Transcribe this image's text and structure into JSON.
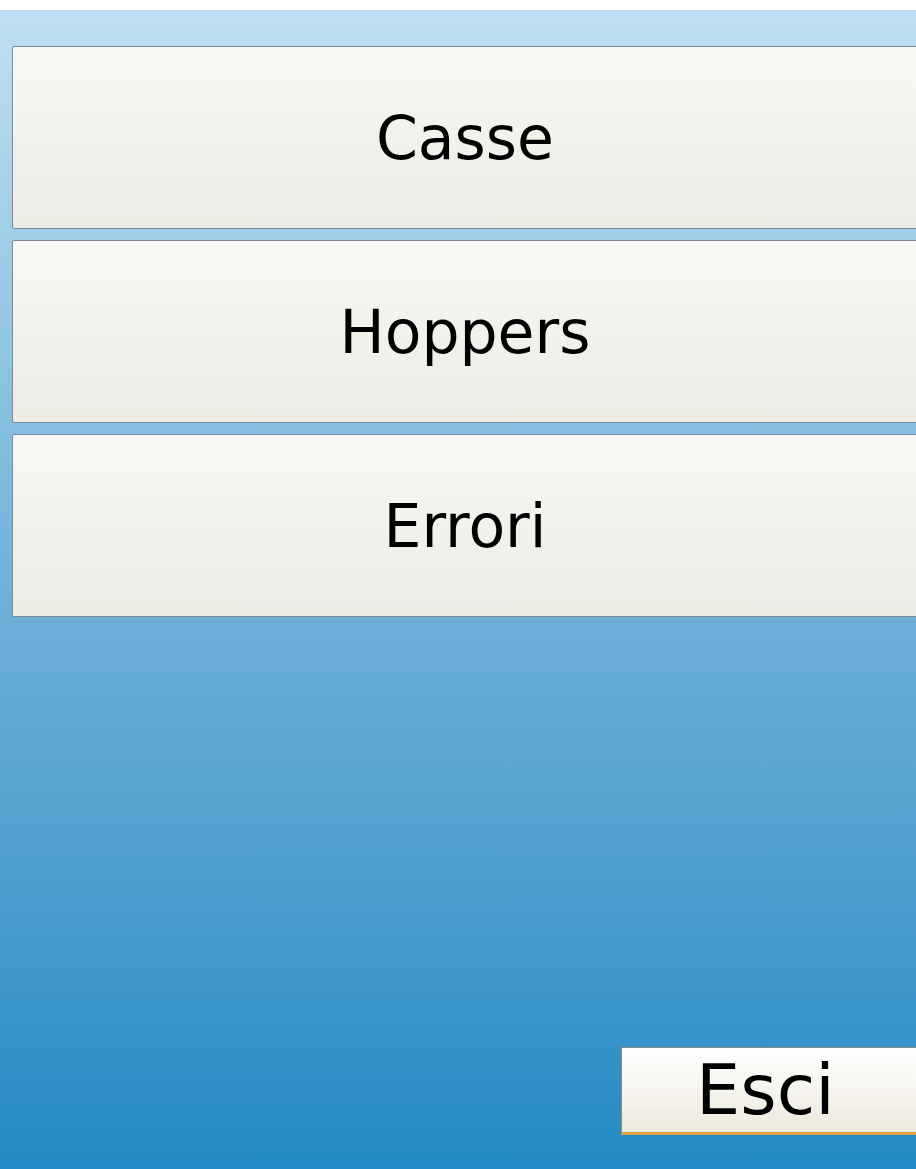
{
  "menu_buttons": [
    {
      "label": "Casse"
    },
    {
      "label": "Hoppers"
    },
    {
      "label": "Errori"
    }
  ],
  "exit_button": {
    "label": "Esci"
  }
}
